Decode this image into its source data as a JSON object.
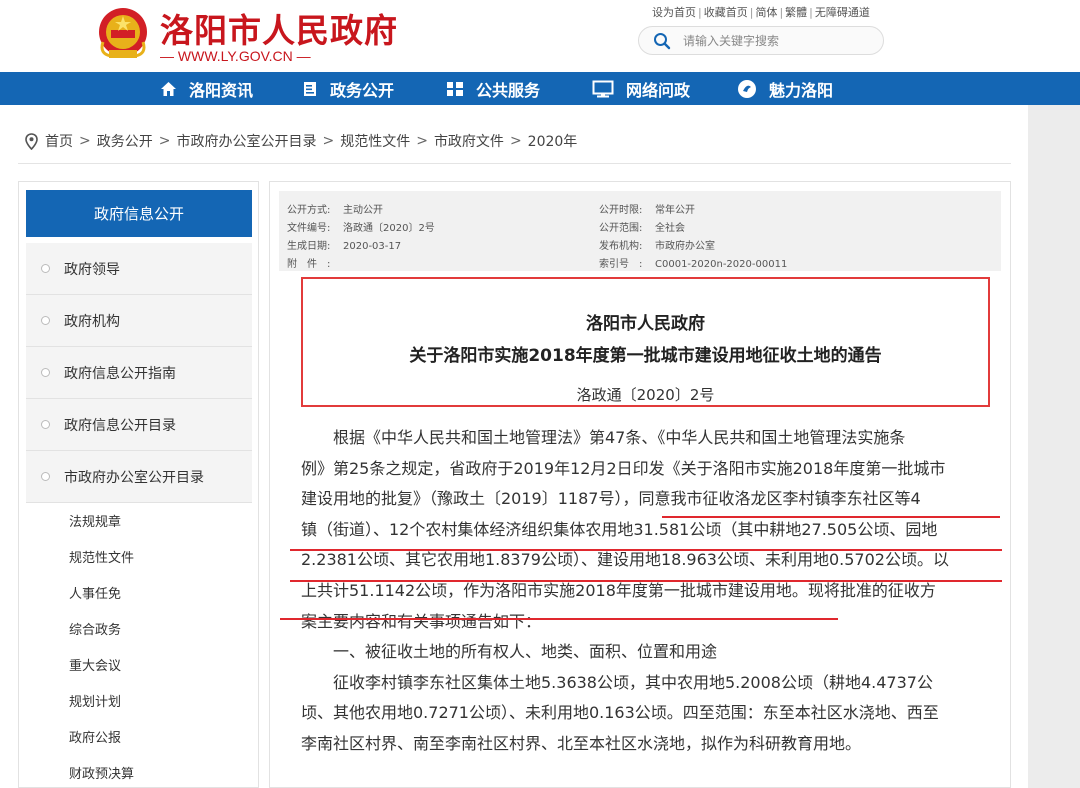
{
  "header": {
    "site_title": "洛阳市人民政府",
    "site_domain": "— WWW.LY.GOV.CN —",
    "top_links": [
      "设为首页",
      "收藏首页",
      "简体",
      "繁體",
      "无障碍通道"
    ],
    "search_placeholder": "请输入关键字搜索"
  },
  "nav": {
    "items": [
      {
        "label": "洛阳资讯",
        "icon": "home-icon"
      },
      {
        "label": "政务公开",
        "icon": "document-icon"
      },
      {
        "label": "公共服务",
        "icon": "grid-icon"
      },
      {
        "label": "网络问政",
        "icon": "monitor-icon"
      },
      {
        "label": "魅力洛阳",
        "icon": "flower-icon"
      }
    ]
  },
  "breadcrumb": [
    "首页",
    "政务公开",
    "市政府办公室公开目录",
    "规范性文件",
    "市政府文件",
    "2020年"
  ],
  "sidebar": {
    "heading": "政府信息公开",
    "items": [
      "政府领导",
      "政府机构",
      "政府信息公开指南",
      "政府信息公开目录",
      "市政府办公室公开目录"
    ],
    "sub_items": [
      "法规规章",
      "规范性文件",
      "人事任免",
      "综合政务",
      "重大会议",
      "规划计划",
      "政府公报",
      "财政预决算"
    ]
  },
  "meta": {
    "left": [
      {
        "key": "公开方式:",
        "value": "主动公开"
      },
      {
        "key": "文件编号:",
        "value": "洛政通〔2020〕2号"
      },
      {
        "key": "生成日期:",
        "value": "2020-03-17"
      },
      {
        "key": "附　件　:",
        "value": ""
      }
    ],
    "right": [
      {
        "key": "公开时限:",
        "value": "常年公开"
      },
      {
        "key": "公开范围:",
        "value": "全社会"
      },
      {
        "key": "发布机构:",
        "value": "市政府办公室"
      },
      {
        "key": "索引号　:",
        "value": "C0001-2020n-2020-00011"
      }
    ]
  },
  "document": {
    "title_line1": "洛阳市人民政府",
    "title_line2": "关于洛阳市实施2018年度第一批城市建设用地征收土地的通告",
    "number": "洛政通〔2020〕2号",
    "lines": [
      "根据《中华人民共和国土地管理法》第47条、《中华人民共和国土地管理法实施条",
      "例》第25条之规定，省政府于2019年12月2日印发《关于洛阳市实施2018年度第一批城市",
      "建设用地的批复》（豫政土〔2019〕1187号），同意我市征收洛龙区李村镇李东社区等4",
      "镇（街道）、12个农村集体经济组织集体农用地31.581公顷（其中耕地27.505公顷、园地",
      "2.2381公顷、其它农用地1.8379公顷）、建设用地18.963公顷、未利用地0.5702公顷。以",
      "上共计51.1142公顷，作为洛阳市实施2018年度第一批城市建设用地。现将批准的征收方",
      "案主要内容和有关事项通告如下：",
      "一、被征收土地的所有权人、地类、面积、位置和用途",
      "征收李村镇李东社区集体土地5.3638公顷，其中农用地5.2008公顷（耕地4.4737公",
      "顷、其他农用地0.7271公顷）、未利用地0.163公顷。四至范围：东至本社区水浇地、西至",
      "李南社区村界、南至李南社区村界、北至本社区水浇地，拟作为科研教育用地。"
    ]
  },
  "colors": {
    "brand_red": "#c8161d",
    "nav_blue": "#1466b4",
    "highlight_red": "#e0282e"
  }
}
